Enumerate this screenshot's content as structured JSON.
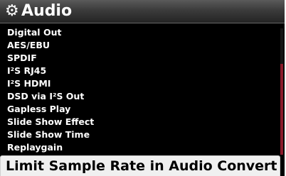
{
  "header": {
    "icon": "gear-icon",
    "title": "Audio"
  },
  "menu": {
    "items": [
      "Digital Out",
      "AES/EBU",
      "SPDIF",
      "I²S RJ45",
      "I²S HDMI",
      "DSD via I²S Out",
      "Gapless Play",
      "Slide Show Effect",
      "Slide Show Time",
      "Replaygain"
    ],
    "selected": "Limit Sample Rate in Audio Convert"
  },
  "colors": {
    "background": "#000000",
    "selected_bg": "#f0f0f0",
    "scrollbar_thumb": "#8b1a2a"
  }
}
